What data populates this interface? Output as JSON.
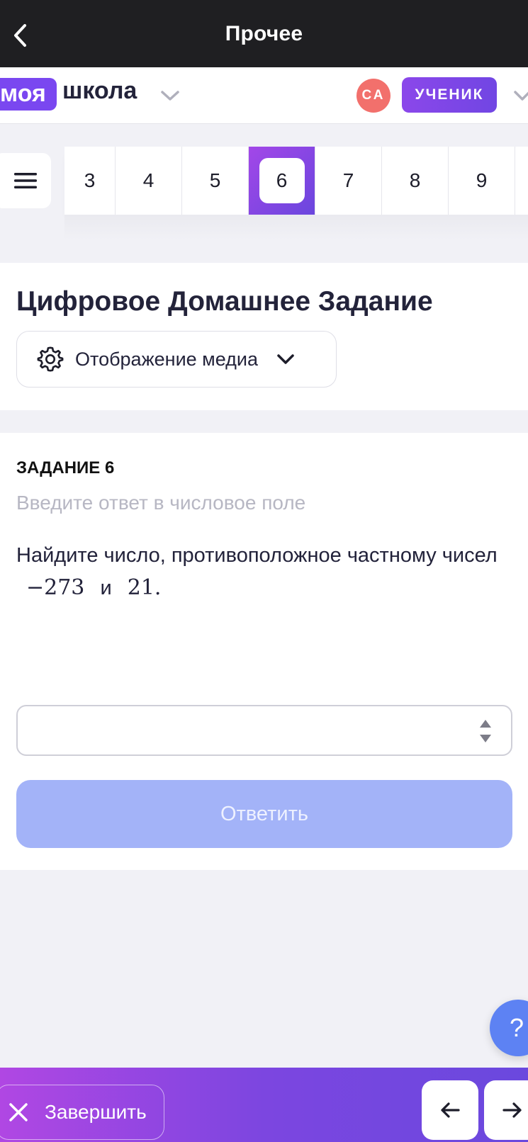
{
  "topbar": {
    "title": "Прочее"
  },
  "brand": {
    "pill": "моя",
    "word": "школа"
  },
  "user": {
    "initials": "СА",
    "role": "УЧЕНИК"
  },
  "tasks": {
    "numbers": [
      "3",
      "4",
      "5",
      "6",
      "7",
      "8",
      "9"
    ],
    "active": "6"
  },
  "header": {
    "title": "Цифровое Домашнее Задание",
    "media_label": "Отображение медиа"
  },
  "task": {
    "label": "ЗАДАНИЕ 6",
    "hint": "Введите ответ в числовое поле",
    "text_part1": "Найдите число, противоположное частному чисел",
    "math1": "−273",
    "text_and": "и",
    "math2": "21.",
    "answer_value": "",
    "submit_label": "Ответить"
  },
  "help": {
    "label": "?"
  },
  "bottom": {
    "finish_label": "Завершить"
  },
  "colors": {
    "accent": "#7a47f0",
    "avatar": "#f2706c",
    "submit_disabled": "#a3b3f8",
    "help": "#5d82f3"
  }
}
